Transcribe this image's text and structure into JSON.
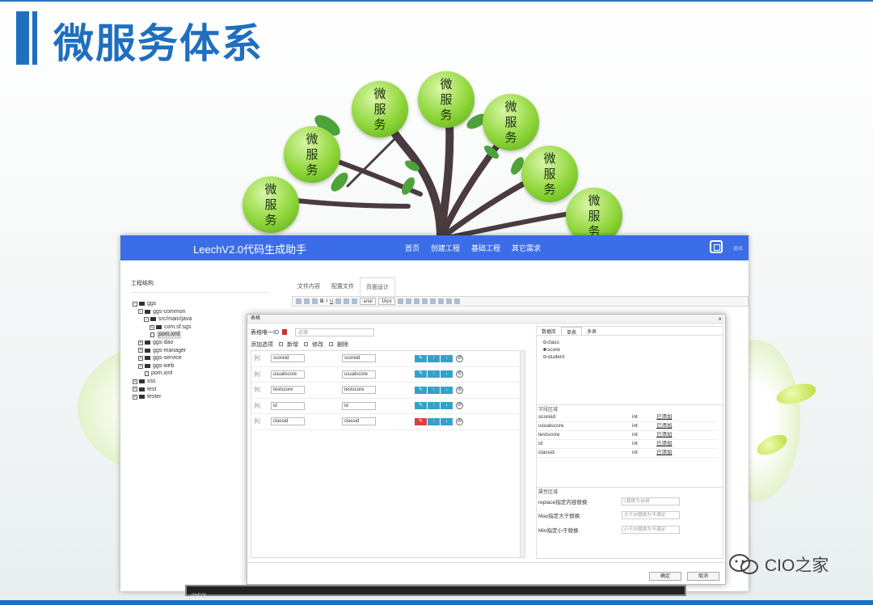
{
  "slide": {
    "title": "微服务体系",
    "accent_color": "#1f6fbf"
  },
  "bubbles": [
    {
      "line1": "微",
      "line2": "服",
      "line3": "务"
    },
    {
      "line1": "微",
      "line2": "服",
      "line3": "务"
    },
    {
      "line1": "微",
      "line2": "服",
      "line3": "务"
    },
    {
      "line1": "微",
      "line2": "服",
      "line3": "务"
    },
    {
      "line1": "微",
      "line2": "服",
      "line3": "务"
    },
    {
      "line1": "微",
      "line2": "服",
      "line3": "务"
    },
    {
      "line1": "微",
      "line2": "服",
      "line3": "务"
    }
  ],
  "app": {
    "title": "LeechV2.0代码生成助手",
    "header_color": "#3b6ee6",
    "nav": [
      "首页",
      "创建工程",
      "基础工程",
      "其它需求"
    ],
    "exit": "退出",
    "tree_header": "工程结构",
    "tree": [
      {
        "label": "ggs",
        "type": "folder"
      },
      {
        "label": "ggs-common",
        "type": "folder"
      },
      {
        "label": "src/main/java",
        "type": "folder"
      },
      {
        "label": "com.sf.sgs",
        "type": "folder"
      },
      {
        "label": "pom.xml",
        "type": "file",
        "selected": true
      },
      {
        "label": "ggs-dao",
        "type": "folder"
      },
      {
        "label": "ggs-manager",
        "type": "folder"
      },
      {
        "label": "ggs-service",
        "type": "folder"
      },
      {
        "label": "ggs-web",
        "type": "folder"
      },
      {
        "label": "pom.xml",
        "type": "file"
      },
      {
        "label": "sss",
        "type": "folder"
      },
      {
        "label": "test",
        "type": "folder"
      },
      {
        "label": "tester",
        "type": "folder"
      }
    ],
    "tabs": [
      "文件内容",
      "配置文件",
      "页面设计"
    ],
    "active_tab": "页面设计",
    "toolbar": {
      "font": "arial",
      "size": "16px"
    }
  },
  "dialog": {
    "title": "表格",
    "close": "×",
    "unique_label": "表格唯一ID",
    "unique_placeholder": "必填",
    "add_options_label": "添加选项",
    "options": [
      "新增",
      "修改",
      "删除"
    ],
    "columns": [
      {
        "label": "列:",
        "name": "scoreid",
        "value": "scoreid",
        "first_red": false
      },
      {
        "label": "列:",
        "name": "usualscore",
        "value": "usualscore",
        "first_red": false
      },
      {
        "label": "列:",
        "name": "testscore",
        "value": "testscore",
        "first_red": false
      },
      {
        "label": "列:",
        "name": "id",
        "value": "id",
        "first_red": false
      },
      {
        "label": "列:",
        "name": "classid",
        "value": "classid",
        "first_red": true
      }
    ],
    "right_tabs": [
      "数据库",
      "单表",
      "多表"
    ],
    "active_right_tab": "单表",
    "tables": [
      {
        "name": "class",
        "checked": false
      },
      {
        "name": "score",
        "checked": true
      },
      {
        "name": "student",
        "checked": false
      }
    ],
    "field_section_title": "字段区域",
    "fields": [
      {
        "name": "scoreid",
        "type": "int",
        "status": "已添加"
      },
      {
        "name": "usualscore",
        "type": "int",
        "status": "已添加"
      },
      {
        "name": "testscore",
        "type": "int",
        "status": "已添加"
      },
      {
        "name": "id",
        "type": "int",
        "status": "已添加"
      },
      {
        "name": "classid",
        "type": "int",
        "status": "已添加"
      }
    ],
    "attr_section_title": "属性区域",
    "attrs": [
      {
        "label": "replace指定内容替换",
        "placeholder": "1替换为'启用'"
      },
      {
        "label": "Max指定大于替换",
        "placeholder": "大于20替换为'不满足'"
      },
      {
        "label": "Min指定小于替换",
        "placeholder": "小于20替换为'不满足'"
      }
    ],
    "ok": "确定",
    "cancel": "取消"
  },
  "console": {
    "text": "[INFO]"
  },
  "watermark": {
    "text": "CIO之家"
  }
}
